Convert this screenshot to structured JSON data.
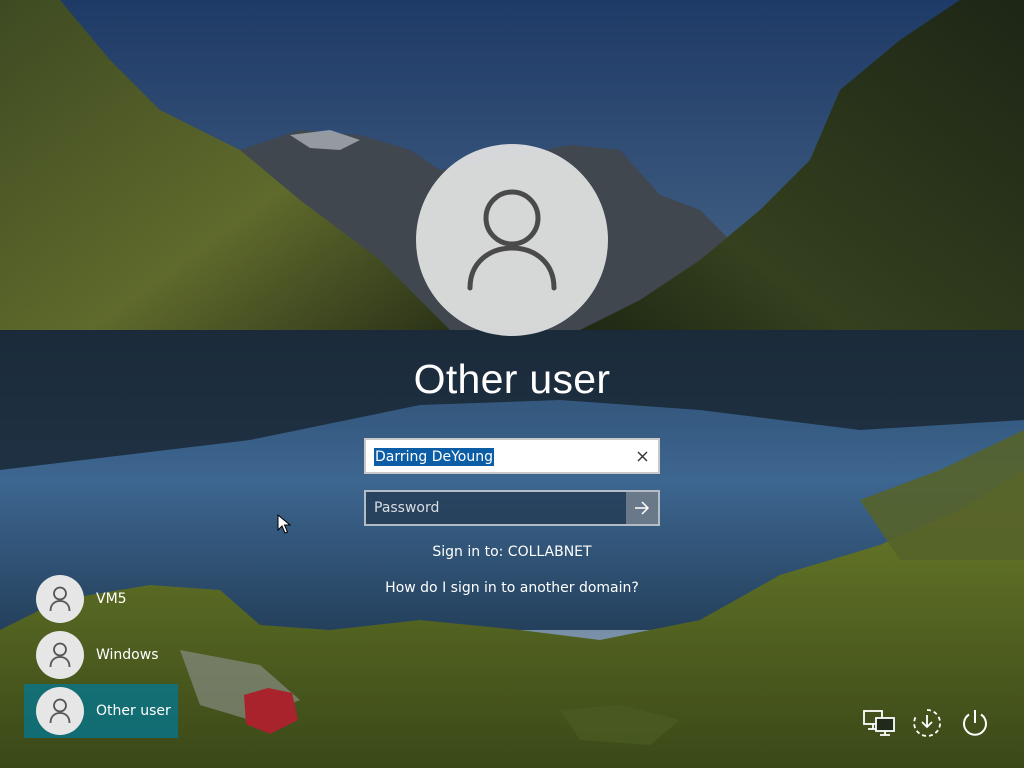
{
  "selected_user": {
    "name": "Other user",
    "avatar_icon": "person-icon"
  },
  "sign_in_form": {
    "username_value": "Darring DeYoung",
    "clear_icon": "close-icon",
    "password_placeholder": "Password",
    "submit_icon": "arrow-right-icon",
    "sign_in_to_text": "Sign in to: COLLABNET",
    "help_link": "How do I sign in to another domain?"
  },
  "user_list": [
    {
      "label": "VM5",
      "icon": "person-icon",
      "selected": false
    },
    {
      "label": "Windows",
      "icon": "person-icon",
      "selected": false
    },
    {
      "label": "Other user",
      "icon": "person-icon",
      "selected": true
    }
  ],
  "system_tray": [
    {
      "icon": "network-icon"
    },
    {
      "icon": "ease-of-access-icon"
    },
    {
      "icon": "power-icon"
    }
  ],
  "colors": {
    "selection_highlight": "#0b5ea6",
    "selected_tile": "#007896"
  }
}
